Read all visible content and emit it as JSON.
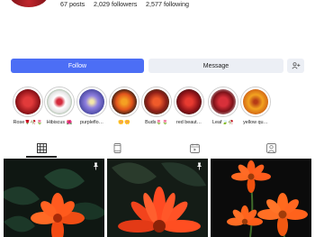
{
  "profile": {
    "posts": "67 posts",
    "followers": "2,029 followers",
    "following": "2,577 following"
  },
  "actions": {
    "follow_label": "Follow",
    "message_label": "Message",
    "add_user_icon": "add-user-icon"
  },
  "highlights": [
    {
      "label": "Rose🌹🥀🌷",
      "color": "#c4262b"
    },
    {
      "label": "Hibiscus 🌺",
      "color": "#f1f1f1"
    },
    {
      "label": "purpleflo…",
      "color": "#7a6cc8"
    },
    {
      "label": "🌼🌼",
      "color": "#e8742a"
    },
    {
      "label": "Buds🌷🌷",
      "color": "#d9442b"
    },
    {
      "label": "red beaut…",
      "color": "#b51d24"
    },
    {
      "label": "Leaf🍃🥀",
      "color": "#b8262d"
    },
    {
      "label": "yellow qu…",
      "color": "#f09d1e"
    }
  ],
  "tabs": [
    {
      "name": "grid-icon",
      "active": true
    },
    {
      "name": "reels-icon",
      "active": false
    },
    {
      "name": "igtv-icon",
      "active": false
    },
    {
      "name": "tagged-icon",
      "active": false
    }
  ],
  "posts": [
    {
      "pinned": true,
      "accent": "#ff5a1f"
    },
    {
      "pinned": true,
      "accent": "#ff4a22"
    },
    {
      "pinned": false,
      "accent": "#ff5b1a"
    }
  ]
}
